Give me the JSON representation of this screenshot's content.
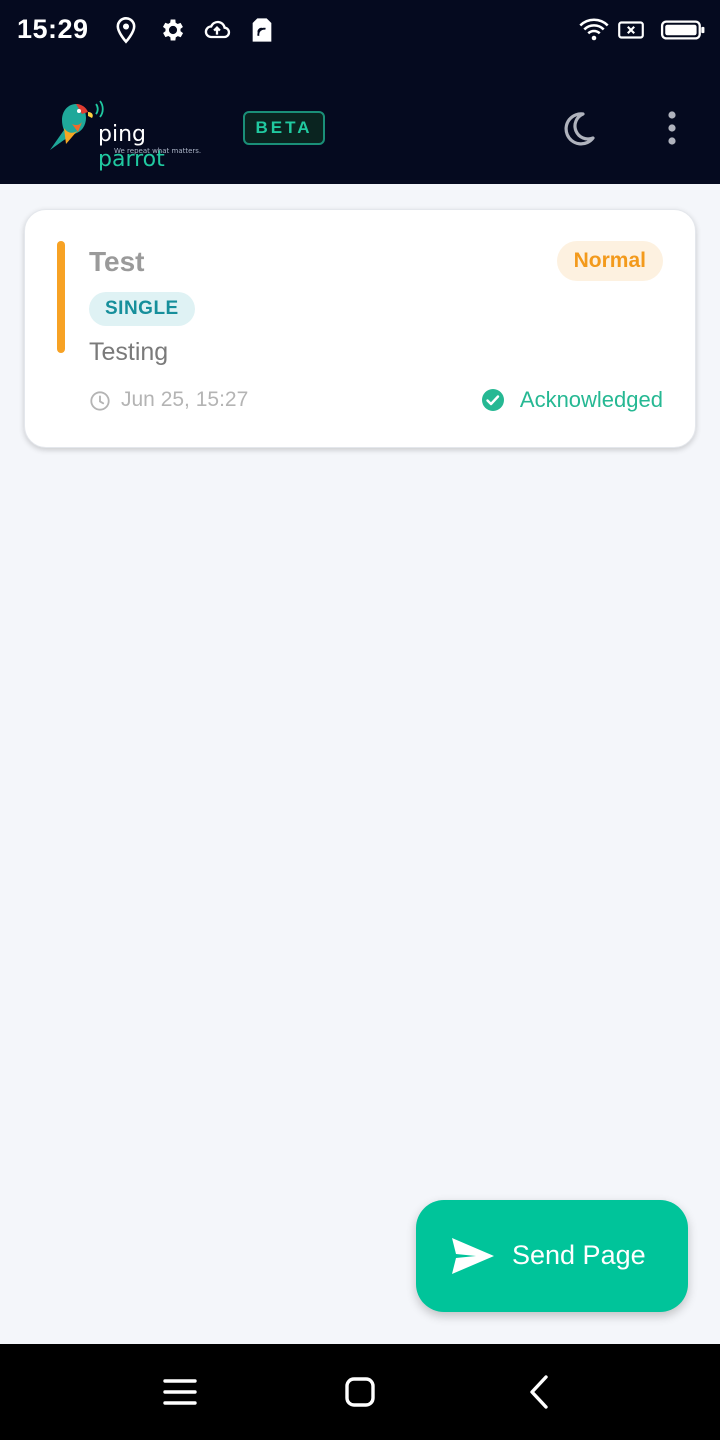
{
  "status_bar": {
    "time": "15:29",
    "left_icons": [
      "location-icon",
      "gear-icon",
      "cloud-upload-icon",
      "sim-card-icon"
    ],
    "right_icons": [
      "wifi-icon",
      "no-sim-icon",
      "battery-icon"
    ]
  },
  "header": {
    "logo_word1": "ping",
    "logo_word2": "parrot",
    "logo_tagline": "We repeat what matters.",
    "beta_label": "BETA",
    "theme_icon": "moon-icon",
    "menu_icon": "more-vertical-icon"
  },
  "pages": [
    {
      "title": "Test",
      "priority": "Normal",
      "type": "SINGLE",
      "message": "Testing",
      "timestamp": "Jun 25, 15:27",
      "status": "Acknowledged"
    }
  ],
  "fab": {
    "label": "Send Page",
    "icon": "send-icon"
  },
  "nav_bar": {
    "icons": [
      "recents-icon",
      "home-icon",
      "back-icon"
    ]
  },
  "colors": {
    "header_bg": "#050a1f",
    "accent_teal": "#00c49a",
    "priority_orange": "#f7a224",
    "ack_green": "#26b893"
  }
}
